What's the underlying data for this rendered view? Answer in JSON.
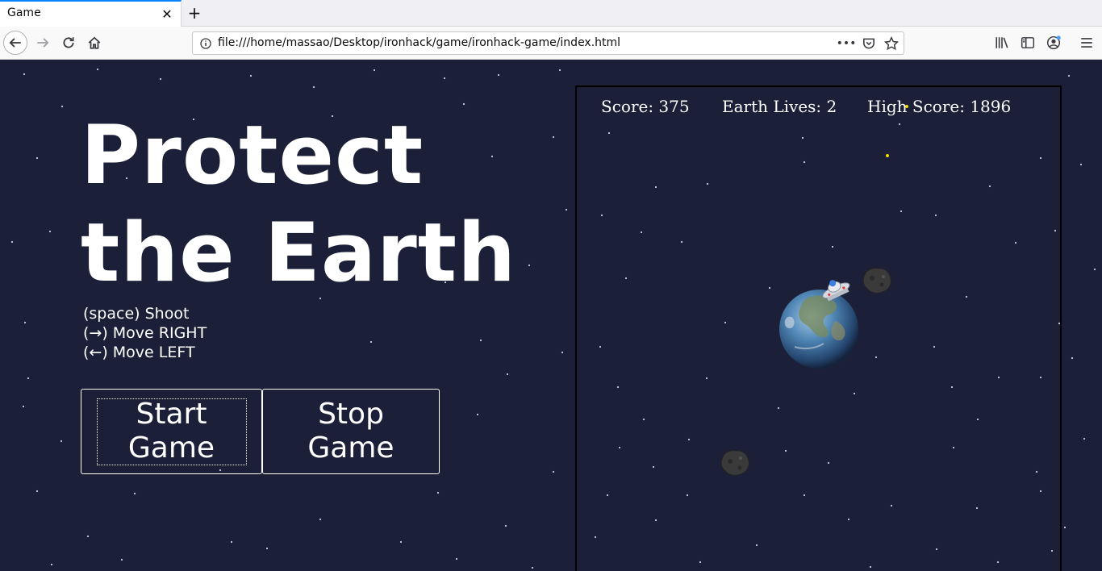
{
  "browser": {
    "tab_title": "Game",
    "url": "file:///home/massao/Desktop/ironhack/game/ironhack-game/index.html"
  },
  "page": {
    "title_line1": "Protect",
    "title_line2": "the Earth",
    "controls": [
      "(space) Shoot",
      "(→) Move RIGHT",
      "(←) Move LEFT"
    ],
    "start_line1": "Start",
    "start_line2": "Game",
    "stop_line1": "Stop",
    "stop_line2": "Game"
  },
  "hud": {
    "score": "Score: 375",
    "lives": "Earth Lives: 2",
    "high_score": "High Score: 1896"
  },
  "colors": {
    "background": "#1b2038",
    "text": "#ffffff",
    "bullet": "#f0e000",
    "asteroid": "#3a3a3a"
  }
}
